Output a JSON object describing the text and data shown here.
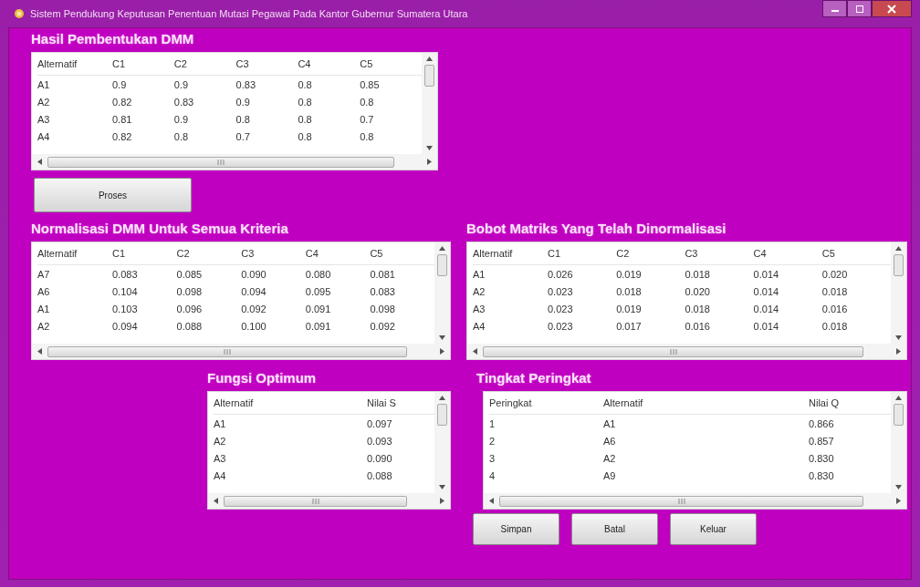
{
  "window": {
    "title": "Sistem Pendukung Keputusan Penentuan Mutasi Pegawai Pada Kantor Gubernur Sumatera Utara"
  },
  "sections": [
    {
      "title": "Hasil Pembentukan DMM",
      "columns": [
        "Alternatif",
        "C1",
        "C2",
        "C3",
        "C4",
        "C5"
      ],
      "rows": [
        [
          "A1",
          "0.9",
          "0.9",
          "0.83",
          "0.8",
          "0.85"
        ],
        [
          "A2",
          "0.82",
          "0.83",
          "0.9",
          "0.8",
          "0.8"
        ],
        [
          "A3",
          "0.81",
          "0.9",
          "0.8",
          "0.8",
          "0.7"
        ],
        [
          "A4",
          "0.82",
          "0.8",
          "0.7",
          "0.8",
          "0.8"
        ]
      ]
    },
    {
      "title": "Normalisasi DMM Untuk Semua Kriteria",
      "columns": [
        "Alternatif",
        "C1",
        "C2",
        "C3",
        "C4",
        "C5"
      ],
      "rows": [
        [
          "A7",
          "0.083",
          "0.085",
          "0.090",
          "0.080",
          "0.081"
        ],
        [
          "A6",
          "0.104",
          "0.098",
          "0.094",
          "0.095",
          "0.083"
        ],
        [
          "A1",
          "0.103",
          "0.096",
          "0.092",
          "0.091",
          "0.098"
        ],
        [
          "A2",
          "0.094",
          "0.088",
          "0.100",
          "0.091",
          "0.092"
        ]
      ]
    },
    {
      "title": "Bobot Matriks Yang Telah Dinormalisasi",
      "columns": [
        "Alternatif",
        "C1",
        "C2",
        "C3",
        "C4",
        "C5"
      ],
      "rows": [
        [
          "A1",
          "0.026",
          "0.019",
          "0.018",
          "0.014",
          "0.020"
        ],
        [
          "A2",
          "0.023",
          "0.018",
          "0.020",
          "0.014",
          "0.018"
        ],
        [
          "A3",
          "0.023",
          "0.019",
          "0.018",
          "0.014",
          "0.016"
        ],
        [
          "A4",
          "0.023",
          "0.017",
          "0.016",
          "0.014",
          "0.018"
        ]
      ]
    },
    {
      "title": "Fungsi Optimum",
      "columns": [
        "Alternatif",
        "Nilai S"
      ],
      "rows": [
        [
          "A1",
          "0.097"
        ],
        [
          "A2",
          "0.093"
        ],
        [
          "A3",
          "0.090"
        ],
        [
          "A4",
          "0.088"
        ]
      ]
    },
    {
      "title": "Tingkat Peringkat",
      "columns": [
        "Peringkat",
        "Alternatif",
        "Nilai Q"
      ],
      "rows": [
        [
          "1",
          "A1",
          "0.866"
        ],
        [
          "2",
          "A6",
          "0.857"
        ],
        [
          "3",
          "A2",
          "0.830"
        ],
        [
          "4",
          "A9",
          "0.830"
        ]
      ]
    }
  ],
  "process_button": "Proses",
  "buttons": [
    "Simpan",
    "Batal",
    "Keluar"
  ]
}
